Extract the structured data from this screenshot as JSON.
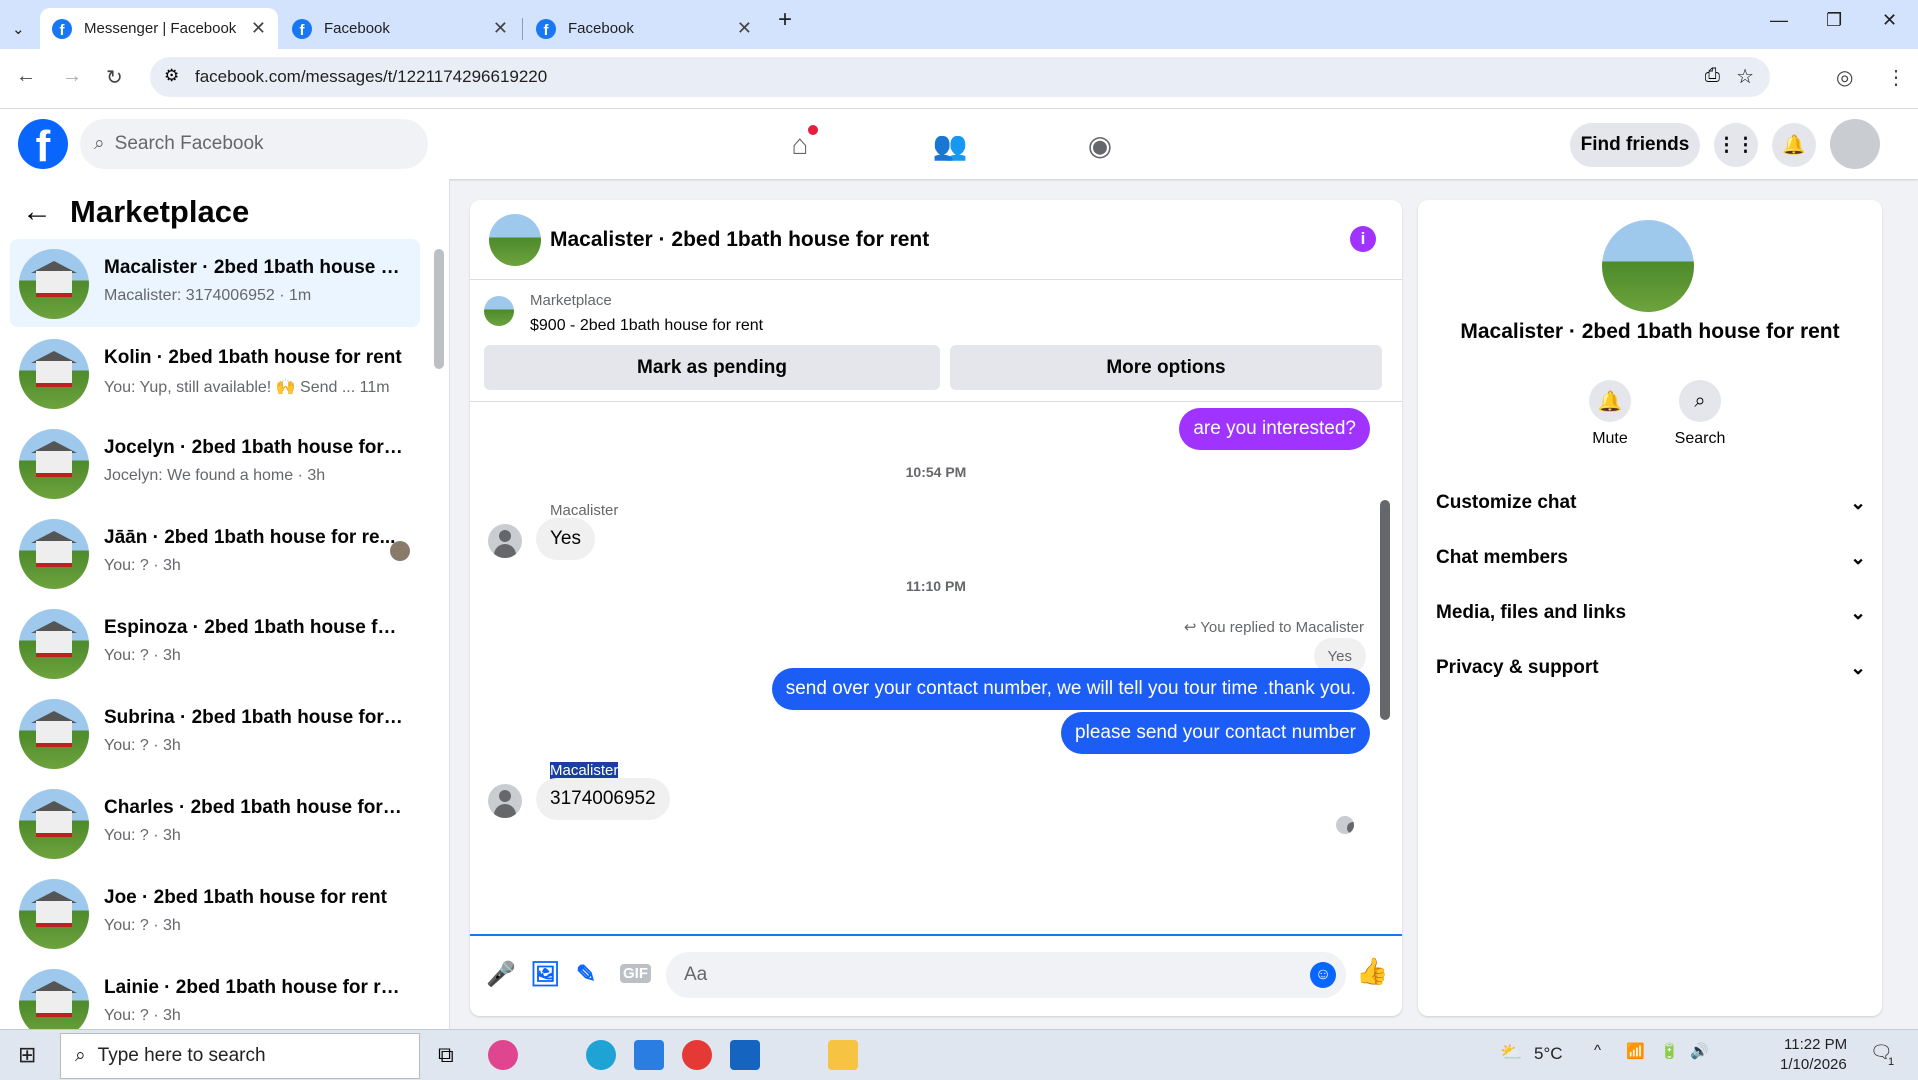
{
  "browser": {
    "tabs": [
      {
        "title": "Messenger | Facebook",
        "active": true
      },
      {
        "title": "Facebook",
        "active": false
      },
      {
        "title": "Facebook",
        "active": false
      }
    ],
    "new_tab": "+",
    "url": "facebook.com/messages/t/1221174296619220",
    "controls": {
      "minimize": "—",
      "maximize": "❐",
      "close": "✕"
    }
  },
  "fb": {
    "logo": "f",
    "search_placeholder": "Search Facebook",
    "find_friends": "Find friends"
  },
  "sidebar": {
    "title": "Marketplace",
    "conversations": [
      {
        "name": "Macalister · 2bed 1bath house fo...",
        "sub": "Macalister: 3174006952 · 1m",
        "selected": true
      },
      {
        "name": "Kolin · 2bed 1bath house for rent",
        "sub": "You: Yup, still available! 🙌 Send ... 11m",
        "selected": false
      },
      {
        "name": "Jocelyn · 2bed 1bath house for r...",
        "sub": "Jocelyn: We found a home · 3h",
        "selected": false
      },
      {
        "name": "Jāān · 2bed 1bath house for re...",
        "sub": "You: ? · 3h",
        "selected": false
      },
      {
        "name": "Espinoza · 2bed 1bath house for ...",
        "sub": "You: ? · 3h",
        "selected": false
      },
      {
        "name": "Subrina · 2bed 1bath house for r...",
        "sub": "You: ? · 3h",
        "selected": false
      },
      {
        "name": "Charles · 2bed 1bath house for r...",
        "sub": "You: ? · 3h",
        "selected": false
      },
      {
        "name": "Joe · 2bed 1bath house for rent",
        "sub": "You: ? · 3h",
        "selected": false
      },
      {
        "name": "Lainie · 2bed 1bath house for rent",
        "sub": "You: ? · 3h",
        "selected": false
      }
    ]
  },
  "chat": {
    "title": "Macalister · 2bed 1bath house for rent",
    "info_icon": "i",
    "marketplace_label": "Marketplace",
    "listing": "$900 - 2bed 1bath house for rent",
    "mark_pending": "Mark as pending",
    "more_options": "More options",
    "messages": {
      "m1": "are you interested?",
      "ts1": "10:54 PM",
      "sender1": "Macalister",
      "m2": "Yes",
      "ts2": "11:10 PM",
      "replied": "You replied to Macalister",
      "quoted": "Yes",
      "m3": "send over your contact number, we will tell you tour time .thank you.",
      "m4": "please send your contact number",
      "sender2": "Macalister",
      "m5": "3174006952"
    },
    "composer_placeholder": "Aa",
    "gif": "GIF"
  },
  "details": {
    "name": "Macalister · 2bed 1bath house for rent",
    "mute": "Mute",
    "search": "Search",
    "sections": [
      "Customize chat",
      "Chat members",
      "Media, files and links",
      "Privacy & support"
    ]
  },
  "taskbar": {
    "search_placeholder": "Type here to search",
    "weather": "5°C",
    "time": "11:22 PM",
    "date": "1/10/2026",
    "notif_count": "1"
  }
}
